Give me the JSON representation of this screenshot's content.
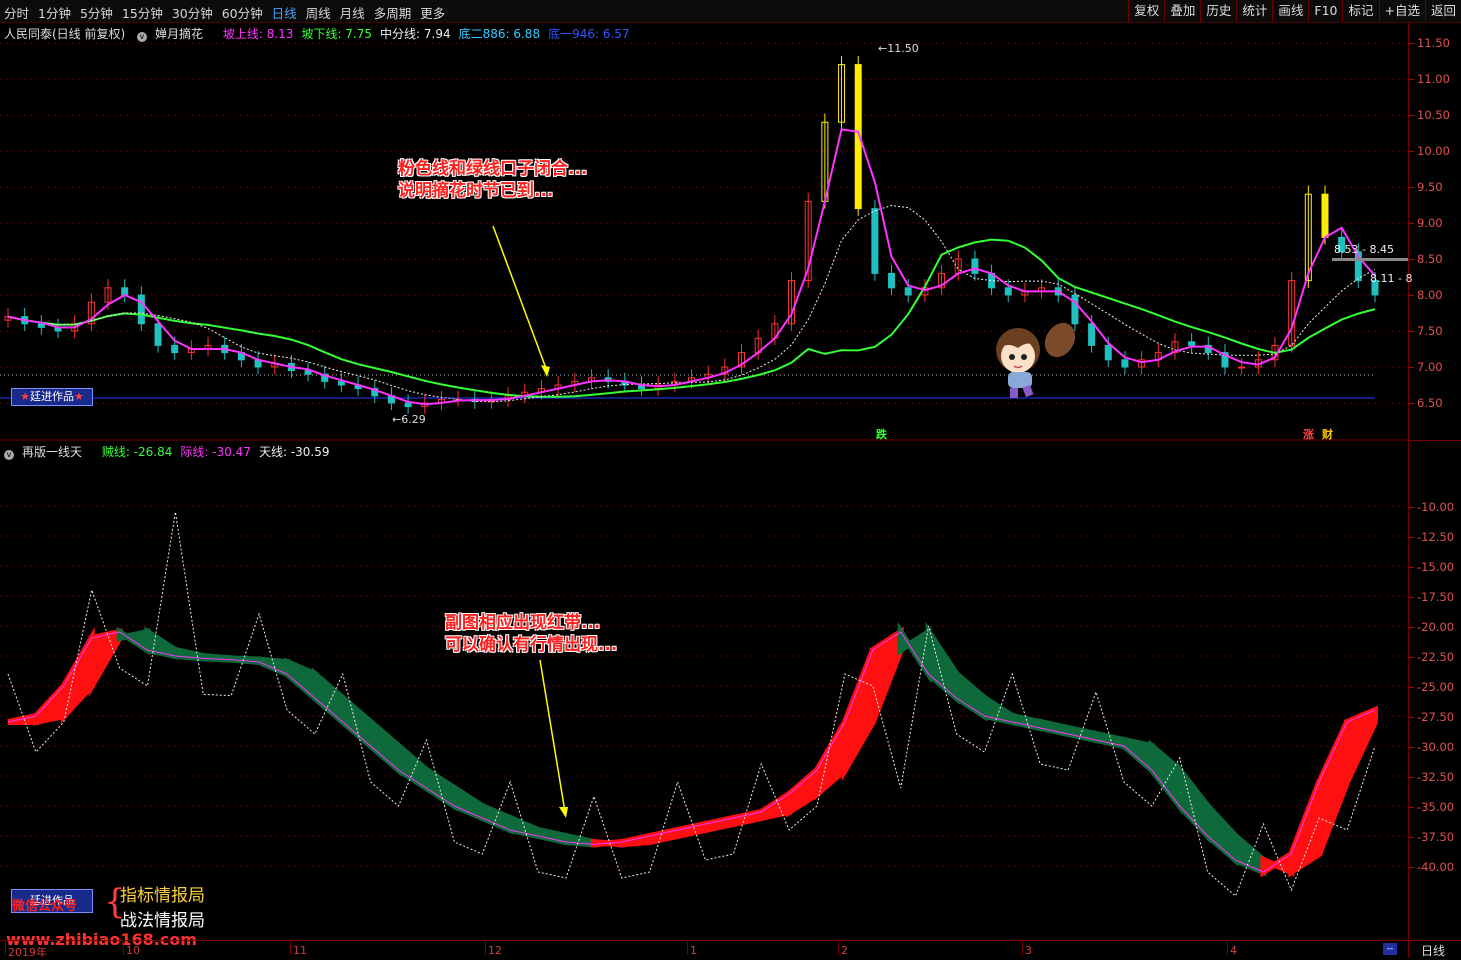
{
  "toolbar": {
    "periods": [
      "分时",
      "1分钟",
      "5分钟",
      "15分钟",
      "30分钟",
      "60分钟",
      "日线",
      "周线",
      "月线",
      "多周期",
      "更多"
    ],
    "active_period": "日线",
    "right_buttons": [
      "复权",
      "叠加",
      "历史",
      "统计",
      "画线",
      "F10",
      "标记",
      "+自选",
      "返回"
    ]
  },
  "main_info": {
    "stock": "人民同泰(日线 前复权)",
    "indicator": "婵月摘花",
    "items": [
      {
        "label": "坡上线: 8.13",
        "color": "#ff33ff"
      },
      {
        "label": "坡下线: 7.75",
        "color": "#33ff33"
      },
      {
        "label": "中分线: 7.94",
        "color": "#eeeeee"
      },
      {
        "label": "底二886: 6.88",
        "color": "#33ccff"
      },
      {
        "label": "底一946: 6.57",
        "color": "#3355ff"
      }
    ]
  },
  "sub_info": {
    "indicator": "再版一线天",
    "items": [
      {
        "label": "贼线: -26.84",
        "color": "#33ff33"
      },
      {
        "label": "际线: -30.47",
        "color": "#ff33ff"
      },
      {
        "label": "天线: -30.59",
        "color": "#eeeeee"
      }
    ]
  },
  "colors": {
    "up": "#ff3030",
    "down": "#20c0c0",
    "pink": "#ff33ff",
    "green": "#33ff33",
    "axis": "#e05050"
  },
  "main_axis": {
    "ticks": [
      "11.50",
      "11.00",
      "10.50",
      "10.00",
      "9.50",
      "9.00",
      "8.50",
      "8.00",
      "7.50",
      "7.00",
      "6.50"
    ]
  },
  "sub_axis": {
    "ticks": [
      "-10.00",
      "-12.50",
      "-15.00",
      "-17.50",
      "-20.00",
      "-22.50",
      "-25.00",
      "-27.50",
      "-30.00",
      "-32.50",
      "-35.00",
      "-37.50",
      "-40.00"
    ]
  },
  "x_axis": {
    "labels": [
      "2019年",
      "10",
      "11",
      "12",
      "1",
      "2",
      "3",
      "4"
    ],
    "corner": "日线",
    "corner_btn": "--"
  },
  "price_labels": {
    "high": "11.50",
    "low": "6.29",
    "range1": "8.53 - 8.45",
    "range2": "8.11 - 8"
  },
  "markers": {
    "die": "跌",
    "zhang": "涨",
    "cai": "财"
  },
  "annotations": {
    "main_line1": "粉色线和绿线口子闭合...",
    "main_line2": "说明摘花时节已到...",
    "sub_line1": "副图相应出现红带...",
    "sub_line2": "可以确认有行情出现..."
  },
  "badges": {
    "work": "廷进作品"
  },
  "watermark": {
    "wechat": "微信公众号",
    "site": "www.zhibiao168.com",
    "brand1": "指标情报局",
    "brand2": "战法情报局"
  }
}
